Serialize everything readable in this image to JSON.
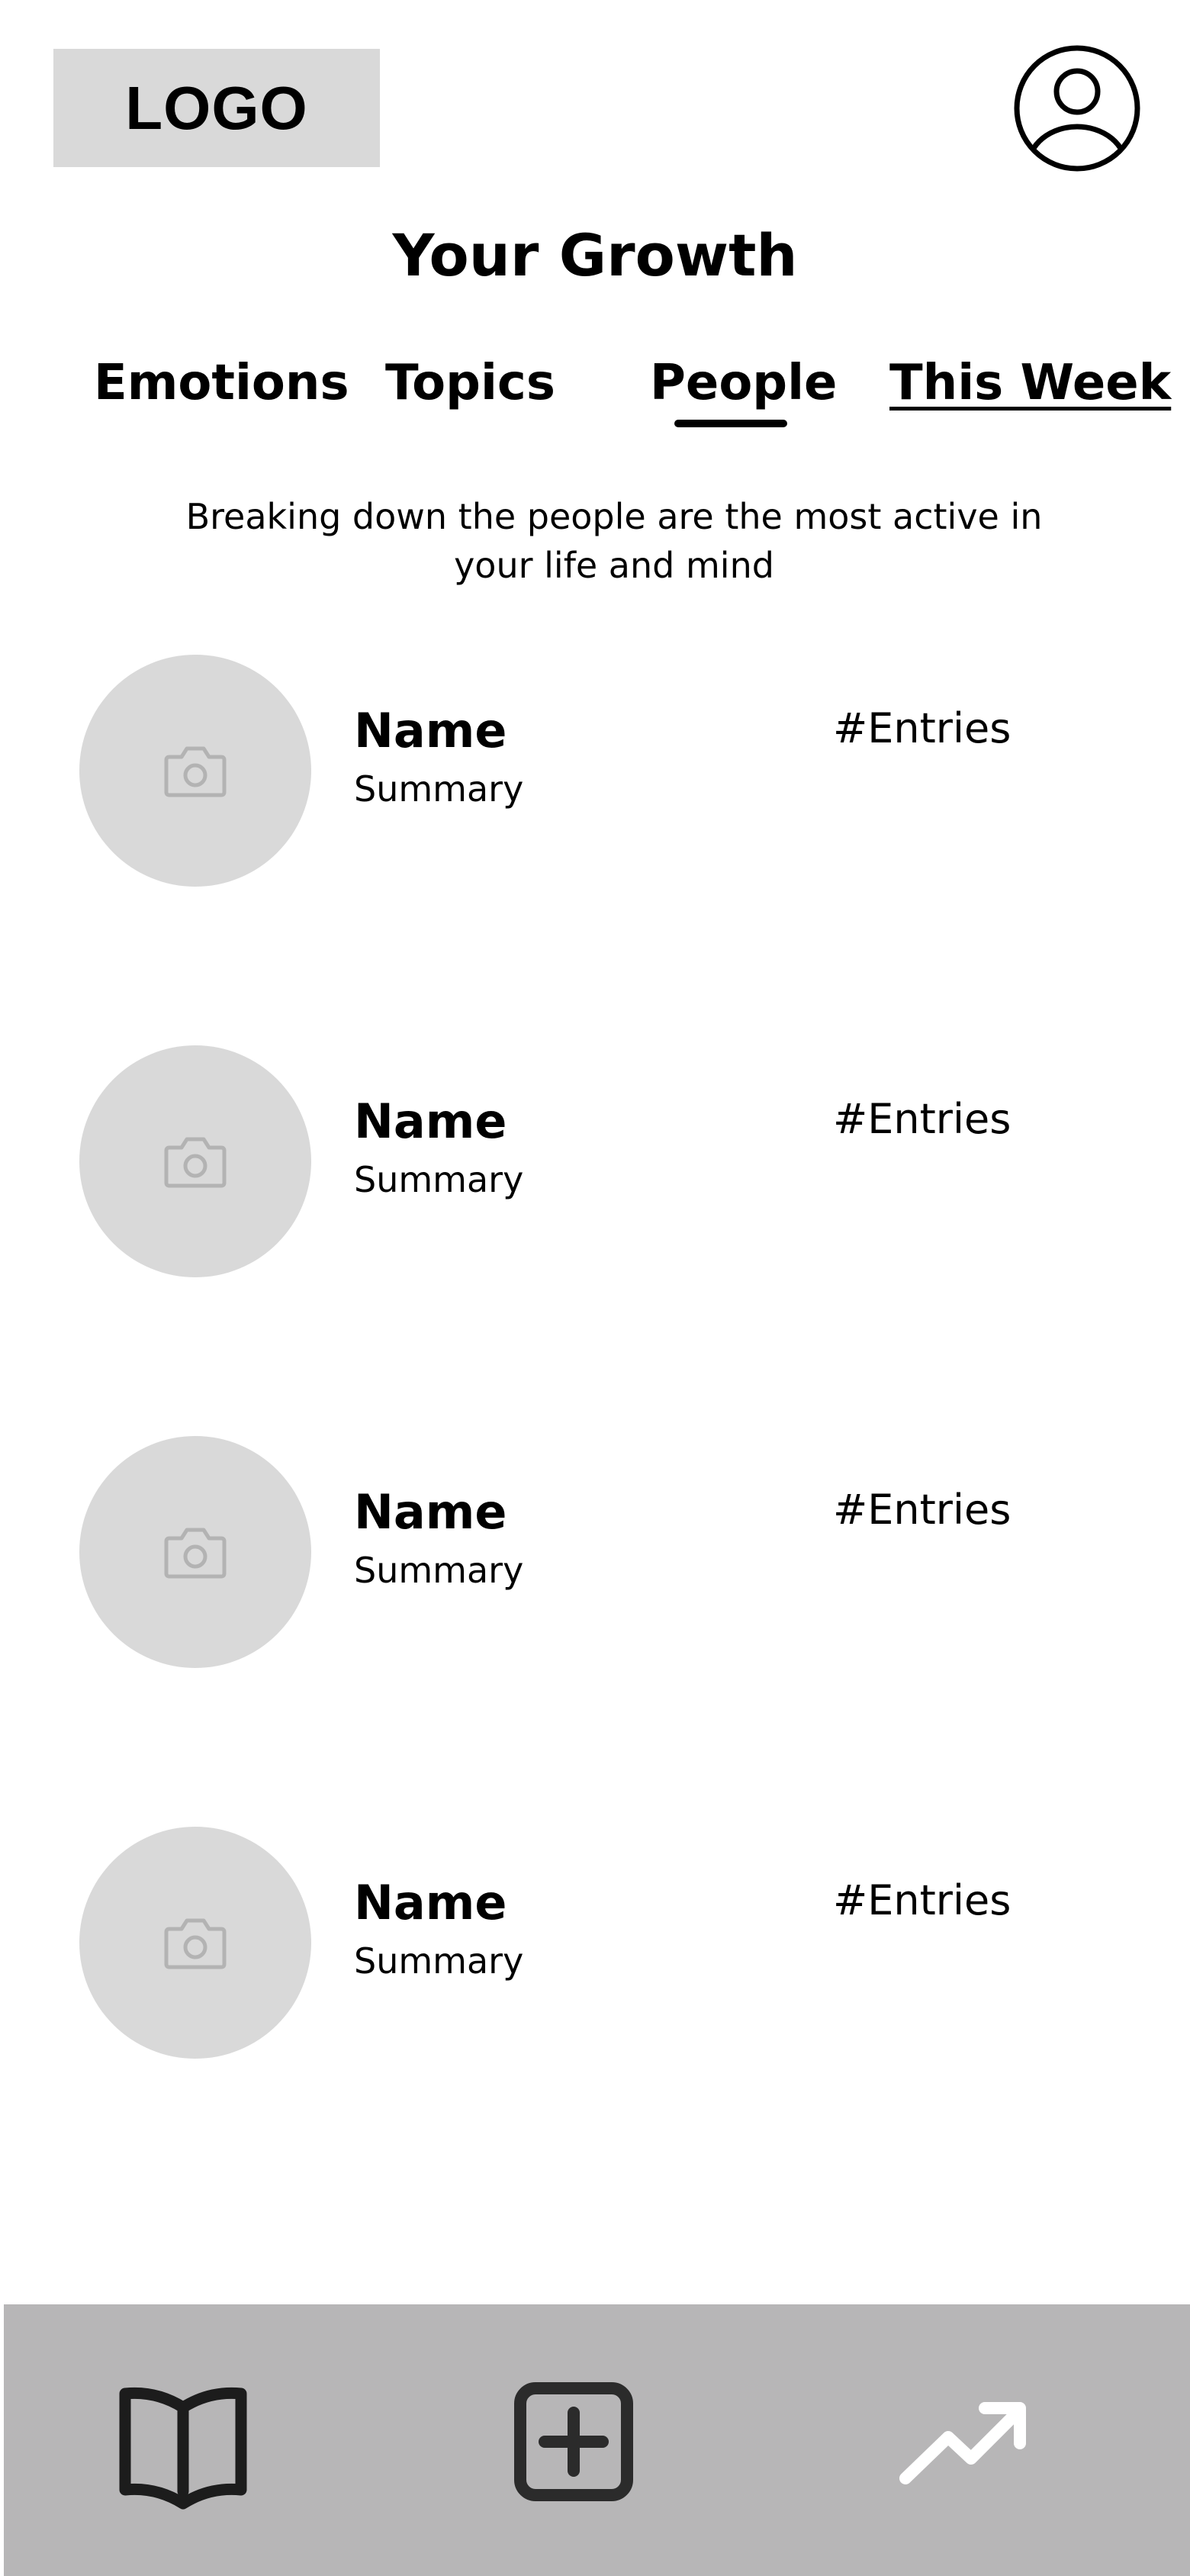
{
  "header": {
    "logo_text": "LOGO",
    "profile_icon": "user-circle-icon"
  },
  "page": {
    "title": "Your Growth",
    "description": "Breaking down the people are the most active in your life and mind"
  },
  "tabs": [
    {
      "label": "Emotions",
      "active": false
    },
    {
      "label": "Topics",
      "active": false
    },
    {
      "label": "People",
      "active": true
    },
    {
      "label": "This Week",
      "active": false
    }
  ],
  "people": [
    {
      "name": "Name",
      "summary": "Summary",
      "entries": "#Entries",
      "avatar_icon": "camera-icon"
    },
    {
      "name": "Name",
      "summary": "Summary",
      "entries": "#Entries",
      "avatar_icon": "camera-icon"
    },
    {
      "name": "Name",
      "summary": "Summary",
      "entries": "#Entries",
      "avatar_icon": "camera-icon"
    },
    {
      "name": "Name",
      "summary": "Summary",
      "entries": "#Entries",
      "avatar_icon": "camera-icon"
    }
  ],
  "bottom_nav": {
    "items": [
      {
        "icon": "open-book-icon"
      },
      {
        "icon": "plus-square-icon"
      },
      {
        "icon": "trending-up-icon"
      }
    ]
  },
  "colors": {
    "placeholder_gray": "#d9d9d9",
    "nav_background": "#b7b6b7",
    "camera_icon_gray": "#b3b3b3",
    "text": "#000000"
  }
}
